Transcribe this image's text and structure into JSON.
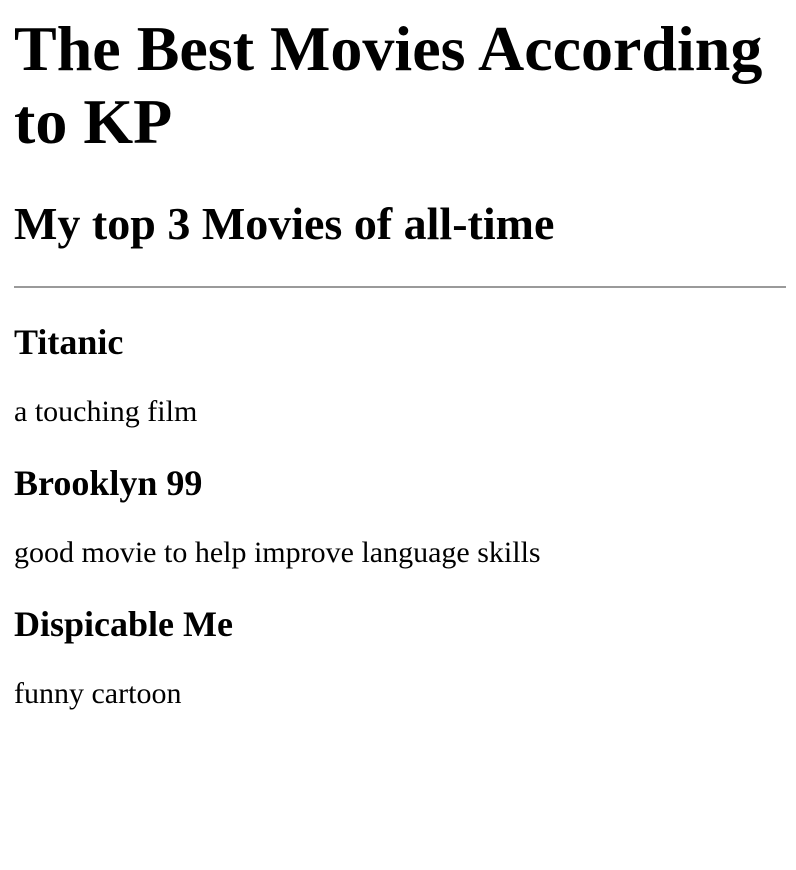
{
  "page": {
    "title": "The Best Movies According to KP",
    "subtitle": "My top 3 Movies of all-time"
  },
  "movies": [
    {
      "title": "Titanic",
      "description": "a touching film"
    },
    {
      "title": "Brooklyn 99",
      "description": "good movie to help improve language skills"
    },
    {
      "title": "Dispicable Me",
      "description": "funny cartoon"
    }
  ]
}
